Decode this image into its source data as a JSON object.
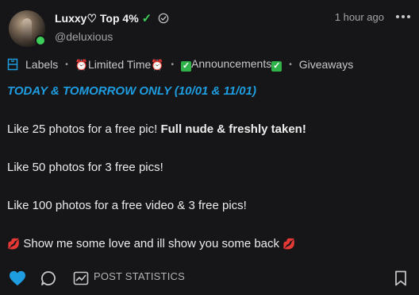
{
  "author": {
    "display_name": "Luxxy♡ Top 4%",
    "check_emoji": "✓",
    "username": "@deluxious",
    "online": true,
    "verified_icon": "verified-badge-icon"
  },
  "timestamp": "1 hour ago",
  "labels": {
    "prefix": "Labels",
    "items": [
      {
        "pre": "⏰",
        "text": "Limited Time",
        "post": "⏰"
      },
      {
        "pre": "✓",
        "text": "Announcements",
        "post": "✓"
      },
      {
        "pre": "",
        "text": "Giveaways",
        "post": ""
      }
    ]
  },
  "post": {
    "promo": "TODAY & TOMORROW ONLY (10/01 & 11/01)",
    "line1_regular": "Like 25 photos for a free pic! ",
    "line1_bold": "Full nude & freshly taken!",
    "line2": "Like 50 photos for 3 free pics!",
    "line3": "Like 100 photos for a free video & 3 free pics!",
    "line4_emoji": "💋",
    "line4_text": " Show me some love and ill show you some back ",
    "line4_emoji_end": "💋"
  },
  "actions": {
    "post_statistics": "POST STATISTICS",
    "liked": true
  },
  "colors": {
    "background": "#161618",
    "accent_blue": "#1e9de0",
    "online_green": "#3ecf5a"
  }
}
